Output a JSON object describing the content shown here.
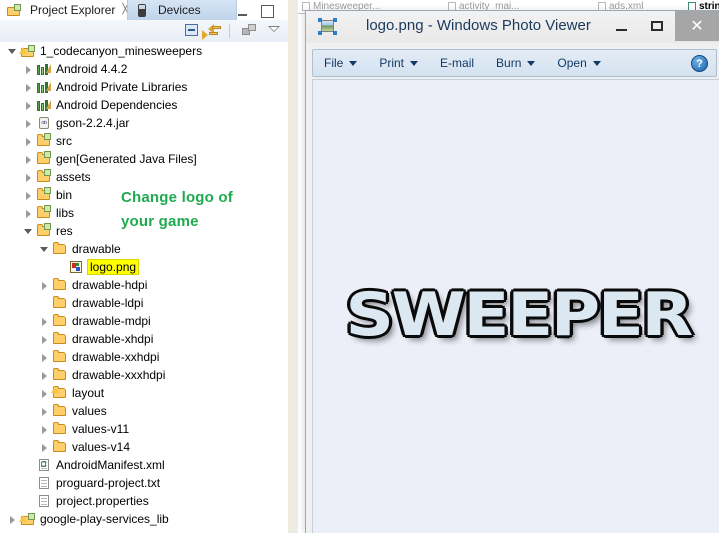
{
  "eclipse": {
    "tabs": [
      {
        "label": "Project Explorer",
        "icon": "project-explorer-icon",
        "close": "╳",
        "active": true
      },
      {
        "label": "Devices",
        "icon": "devices-icon",
        "active": false
      }
    ],
    "view_toolbar": [
      {
        "name": "collapse-all-icon"
      },
      {
        "name": "link-with-editor-icon"
      },
      {
        "name": "view-menu-icon"
      },
      {
        "name": "view-dropdown-icon"
      }
    ],
    "window_buttons": {
      "minimize": "minimize-icon",
      "maximize": "maximize-icon"
    },
    "tree": [
      {
        "indent": 0,
        "arrow": "expanded",
        "icon": "android-project-icon",
        "label": "1_codecanyon_minesweepers"
      },
      {
        "indent": 1,
        "arrow": "collapsed",
        "icon": "library-icon",
        "label": "Android 4.4.2"
      },
      {
        "indent": 1,
        "arrow": "collapsed",
        "icon": "library-icon",
        "label": "Android Private Libraries"
      },
      {
        "indent": 1,
        "arrow": "collapsed",
        "icon": "library-icon",
        "label": "Android Dependencies"
      },
      {
        "indent": 1,
        "arrow": "collapsed",
        "icon": "jar-icon",
        "label": "gson-2.2.4.jar"
      },
      {
        "indent": 1,
        "arrow": "collapsed",
        "icon": "source-folder-icon",
        "label": "src"
      },
      {
        "indent": 1,
        "arrow": "collapsed",
        "icon": "gen-folder-icon",
        "label": "gen",
        "sub": " [Generated Java Files]"
      },
      {
        "indent": 1,
        "arrow": "collapsed",
        "icon": "package-folder-icon",
        "label": "assets"
      },
      {
        "indent": 1,
        "arrow": "collapsed",
        "icon": "package-folder-icon",
        "label": "bin"
      },
      {
        "indent": 1,
        "arrow": "collapsed",
        "icon": "package-folder-icon",
        "label": "libs"
      },
      {
        "indent": 1,
        "arrow": "expanded",
        "icon": "package-folder-icon",
        "label": "res"
      },
      {
        "indent": 2,
        "arrow": "expanded",
        "icon": "folder-icon",
        "label": "drawable"
      },
      {
        "indent": 3,
        "arrow": "none",
        "icon": "png-image-icon",
        "label": "logo.png",
        "highlight": true
      },
      {
        "indent": 2,
        "arrow": "collapsed",
        "icon": "folder-icon",
        "label": "drawable-hdpi"
      },
      {
        "indent": 2,
        "arrow": "none",
        "icon": "folder-icon",
        "label": "drawable-ldpi"
      },
      {
        "indent": 2,
        "arrow": "collapsed",
        "icon": "folder-icon",
        "label": "drawable-mdpi"
      },
      {
        "indent": 2,
        "arrow": "collapsed",
        "icon": "folder-icon",
        "label": "drawable-xhdpi"
      },
      {
        "indent": 2,
        "arrow": "collapsed",
        "icon": "folder-icon",
        "label": "drawable-xxhdpi"
      },
      {
        "indent": 2,
        "arrow": "collapsed",
        "icon": "folder-icon",
        "label": "drawable-xxxhdpi"
      },
      {
        "indent": 2,
        "arrow": "collapsed",
        "icon": "warn-folder-icon",
        "label": "layout"
      },
      {
        "indent": 2,
        "arrow": "collapsed",
        "icon": "folder-icon",
        "label": "values"
      },
      {
        "indent": 2,
        "arrow": "collapsed",
        "icon": "folder-icon",
        "label": "values-v11"
      },
      {
        "indent": 2,
        "arrow": "collapsed",
        "icon": "folder-icon",
        "label": "values-v14"
      },
      {
        "indent": 1,
        "arrow": "none",
        "icon": "xml-file-icon",
        "label": "AndroidManifest.xml"
      },
      {
        "indent": 1,
        "arrow": "none",
        "icon": "text-file-icon",
        "label": "proguard-project.txt"
      },
      {
        "indent": 1,
        "arrow": "none",
        "icon": "text-file-icon",
        "label": "project.properties"
      },
      {
        "indent": 0,
        "arrow": "collapsed",
        "icon": "android-project-icon",
        "label": "google-play-services_lib"
      }
    ],
    "annotation": {
      "line1": "Change logo of",
      "line2": "your game",
      "color": "#1faa4f"
    },
    "editor_tabs": [
      {
        "label": "Minesweeper...",
        "icon": "java-file-icon",
        "active": false
      },
      {
        "label": "activity_mai...",
        "icon": "xml-file-icon",
        "active": false
      },
      {
        "label": "ads.xml",
        "icon": "xml-file-icon",
        "active": false
      },
      {
        "label": "strings.",
        "icon": "xml-file-icon",
        "active": true
      }
    ]
  },
  "viewer": {
    "title": "logo.png - Windows Photo Viewer",
    "icon": "photo-viewer-icon",
    "window_buttons": {
      "minimize": "minimize-icon",
      "maximize": "maximize-icon",
      "close_label": "✕"
    },
    "toolbar": [
      {
        "label": "File",
        "has_caret": true
      },
      {
        "label": "Print",
        "has_caret": true
      },
      {
        "label": "E-mail",
        "has_caret": false
      },
      {
        "label": "Burn",
        "has_caret": true
      },
      {
        "label": "Open",
        "has_caret": true
      }
    ],
    "help_label": "?",
    "canvas": {
      "background": "#eceff8",
      "image_text": "SWEEPER",
      "image_style": "grunge outlined logo"
    }
  }
}
